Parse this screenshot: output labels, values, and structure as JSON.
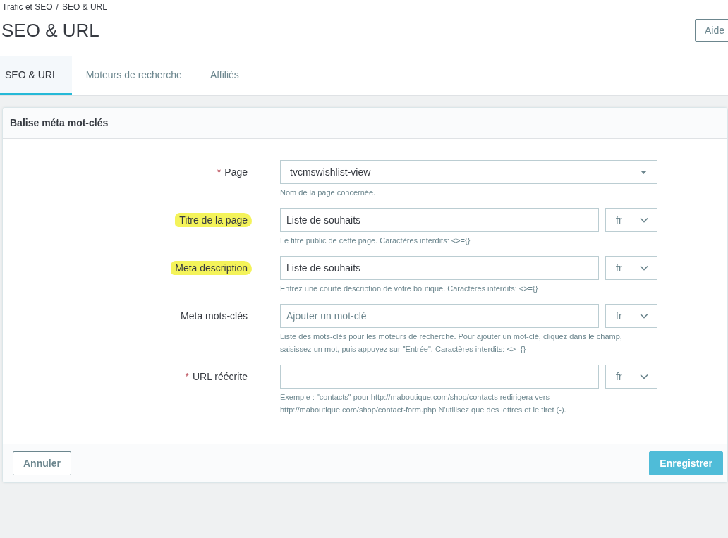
{
  "breadcrumb": [
    "Trafic et SEO",
    "SEO & URL"
  ],
  "breadcrumb_separator": "/",
  "title": "SEO & URL",
  "help_button": "Aide",
  "tabs": [
    {
      "label": "SEO & URL",
      "selected": true
    },
    {
      "label": "Moteurs de recherche",
      "selected": false
    },
    {
      "label": "Affiliés",
      "selected": false
    }
  ],
  "panel": {
    "title": "Balise méta mot-clés",
    "fields": [
      {
        "kind": "select",
        "label": "Page",
        "required_mark": "*",
        "highlighted": false,
        "value": "tvcmswishlist-view",
        "help": "Nom de la page concernée."
      },
      {
        "kind": "text",
        "label": "Titre de la page",
        "highlighted": true,
        "value": "Liste de souhaits",
        "lang": "fr",
        "help": "Le titre public de cette page. Caractères interdits: <>={}"
      },
      {
        "kind": "text",
        "label": "Meta description",
        "highlighted": true,
        "value": "Liste de souhaits",
        "lang": "fr",
        "help": "Entrez une courte description de votre boutique. Caractères interdits: <>={}"
      },
      {
        "kind": "text",
        "label": "Meta mots-clés",
        "highlighted": false,
        "placeholder": "Ajouter un mot-clé",
        "lang": "fr",
        "help": "Liste des mots-clés pour les moteurs de recherche. Pour ajouter un mot-clé, cliquez dans le champ, saisissez un mot, puis appuyez sur \"Entrée\". Caractères interdits: <>={}"
      },
      {
        "kind": "text",
        "label": "URL réécrite",
        "required_mark": "*",
        "highlighted": false,
        "lang": "fr",
        "help": "Exemple : \"contacts\" pour http://maboutique.com/shop/contacts redirigera vers http://maboutique.com/shop/contact-form.php N'utilisez que des lettres et le tiret (-)."
      }
    ],
    "cancel_button": "Annuler",
    "save_button": "Enregistrer"
  }
}
